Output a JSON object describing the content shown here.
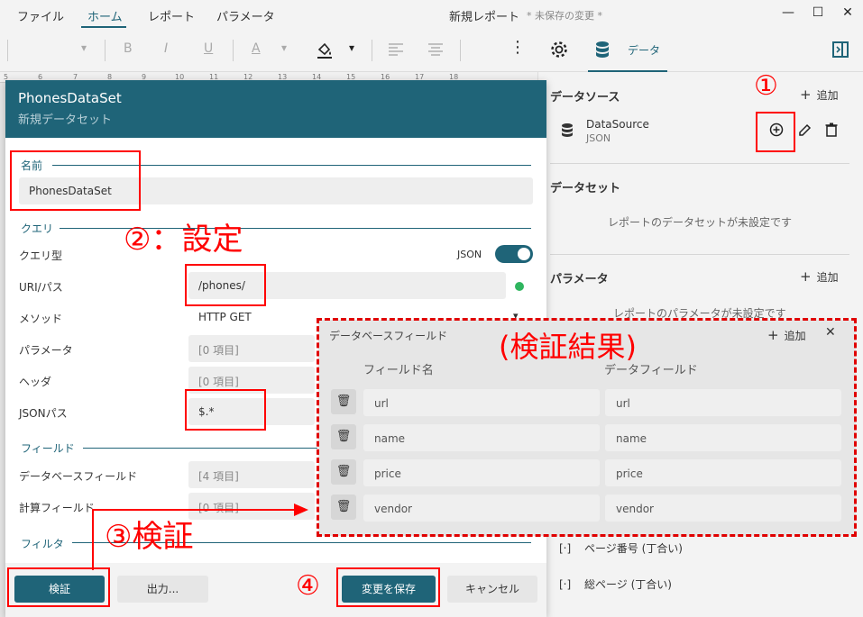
{
  "menubar": {
    "items": [
      "ファイル",
      "ホーム",
      "レポート",
      "パラメータ"
    ],
    "doc_title": "新規レポート",
    "unsaved": "* 未保存の変更 *",
    "win_minimize": "—",
    "win_maximize": "☐",
    "win_close": "✕"
  },
  "toolbar": {
    "bold": "B",
    "italic": "I",
    "underline": "U",
    "font_color": "A",
    "more": "⋮",
    "data_tab": "データ"
  },
  "ruler": [
    "5",
    "6",
    "7",
    "8",
    "9",
    "10",
    "11",
    "12",
    "13",
    "14",
    "15",
    "16",
    "17",
    "18"
  ],
  "right_panel": {
    "datasource_title": "データソース",
    "add_label": "追加",
    "datasource": {
      "name": "DataSource",
      "type": "JSON"
    },
    "dataset_title": "データセット",
    "dataset_empty": "レポートのデータセットが未設定です",
    "parameter_title": "パラメータ",
    "parameter_empty": "レポートのパラメータが未設定です",
    "page_items": [
      "ページ番号 (丁合い)",
      "総ページ (丁合い)"
    ]
  },
  "dialog": {
    "title": "PhonesDataSet",
    "subtitle": "新規データセット",
    "group_name": "名前",
    "name_value": "PhonesDataSet",
    "group_query": "クエリ",
    "query_type_label": "クエリ型",
    "query_type_value": "JSON",
    "uri_label": "URI/パス",
    "uri_value": "/phones/",
    "method_label": "メソッド",
    "method_value": "HTTP GET",
    "params_label": "パラメータ",
    "params_value": "[0 項目]",
    "headers_label": "ヘッダ",
    "headers_value": "[0 項目]",
    "jsonpath_label": "JSONパス",
    "jsonpath_value": "$.*",
    "group_fields": "フィールド",
    "dbfields_label": "データベースフィールド",
    "dbfields_value": "[4 項目]",
    "calcfields_label": "計算フィールド",
    "calcfields_value": "[0 項目]",
    "group_filter": "フィルタ",
    "btn_validate": "検証",
    "btn_output": "出力...",
    "btn_save": "変更を保存",
    "btn_cancel": "キャンセル"
  },
  "field_panel": {
    "title": "データベースフィールド",
    "add": "追加",
    "col_field_name": "フィールド名",
    "col_data_field": "データフィールド",
    "rows": [
      {
        "name": "url",
        "data": "url"
      },
      {
        "name": "name",
        "data": "name"
      },
      {
        "name": "price",
        "data": "price"
      },
      {
        "name": "vendor",
        "data": "vendor"
      }
    ]
  },
  "annotations": {
    "a1": "①",
    "a2": "②：設定",
    "a3": "③検証",
    "a4": "④",
    "result": "(検証結果)"
  },
  "colors": {
    "accent": "#1f6478",
    "annotation": "#ff0000",
    "status_ok": "#2fb55f"
  }
}
